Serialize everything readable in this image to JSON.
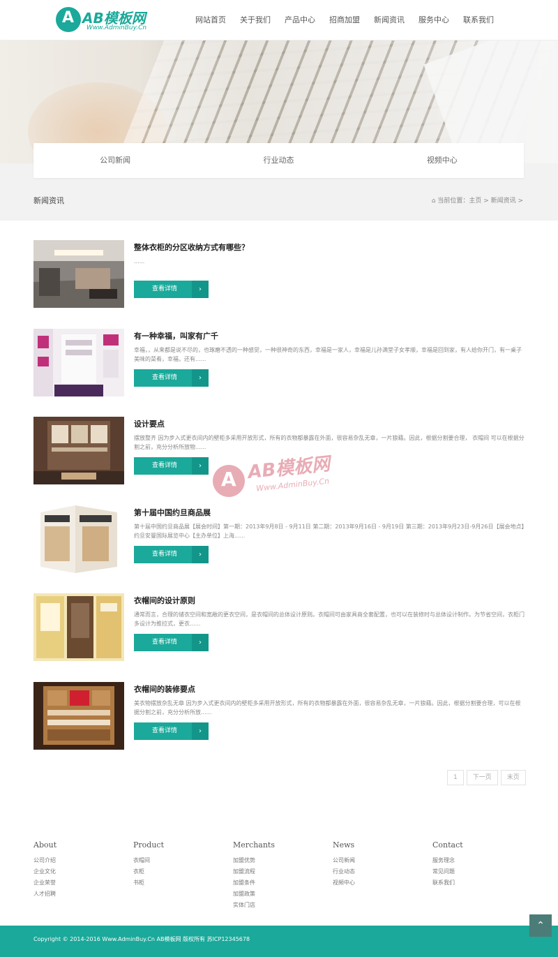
{
  "colors": {
    "accent": "#1aa99a",
    "accent_dark": "#12968a",
    "watermark": "#d76a7a"
  },
  "logo": {
    "text": "AB模板网",
    "letter": "A",
    "url": "Www.AdminBuy.Cn"
  },
  "nav": [
    "网站首页",
    "关于我们",
    "产品中心",
    "招商加盟",
    "新闻资讯",
    "服务中心",
    "联系我们"
  ],
  "tabs": [
    "公司新闻",
    "行业动态",
    "视频中心"
  ],
  "breadcrumb": {
    "page_title": "新闻资讯",
    "home_icon": "home-icon",
    "trail": "当前位置：主页 > 新闻资讯 >"
  },
  "articles": [
    {
      "title": "整体衣柜的分区收纳方式有哪些？",
      "desc": "......",
      "button": "查看详情",
      "arrow": "›",
      "image": "office-wardrobe-photo"
    },
    {
      "title": "有一种幸福，叫家有广千",
      "desc": "幸福，，从来都是说不尽的，也琢磨不透的一种感觉，一种很神奇的东西，幸福是一家人，幸福是儿孙满堂子女孝顺，幸福是回到家，有人给你开门，有一桌子美味的菜肴，幸福，还有......",
      "button": "查看详情",
      "arrow": "›",
      "image": "pink-closet-photo"
    },
    {
      "title": "设计要点",
      "desc": "摆放整齐 因为步入式更衣间内的壁柜多采用开放形式，所有的衣物都暴露在外面，很容易杂乱无章，一片狼藉。因此，根据分割要合理， 衣帽间 可以在根据分割之前，充分分析所放物......",
      "button": "查看详情",
      "arrow": "›",
      "image": "walk-in-closet-photo"
    },
    {
      "title": "第十届中国约旦商品展",
      "desc": "第十届中国约旦商品展【展会时间】第一期：2013年9月8日 - 9月11日 第二期：2013年9月16日 - 9月19日 第三期：2013年9月23日-9月26日【展会地点】约旦安曼国际展览中心【主办单位】上海......",
      "button": "查看详情",
      "arrow": "›",
      "image": "white-wardrobe-photo"
    },
    {
      "title": "衣帽间的设计原则",
      "desc": "通常而言，合理的储衣空间和宽敞的更衣空间，是衣帽间的总体设计原则。衣帽间可由家具商全套配置，也可以在装修时与总体设计制作。为节省空间，衣柜门多设计为推拉式，更衣......",
      "button": "查看详情",
      "arrow": "›",
      "image": "yellow-closet-photo"
    },
    {
      "title": "衣帽间的装修要点",
      "desc": "美衣物摆放杂乱无章 因为步入式更衣间内的壁柜多采用开放形式，所有的衣物都暴露在外面，很容易杂乱无章，一片狼藉。因此，根据分割要合理，可以在根据分割之前，充分分析所放......",
      "button": "查看详情",
      "arrow": "›",
      "image": "wood-shelves-photo"
    }
  ],
  "pagination": [
    "1",
    "下一页",
    "末页"
  ],
  "watermark": {
    "letter": "A",
    "text": "AB模板网",
    "url": "Www.AdminBuy.Cn"
  },
  "footer": {
    "columns": [
      {
        "title": "About",
        "links": [
          "公司介绍",
          "企业文化",
          "企业荣誉",
          "人才招聘"
        ]
      },
      {
        "title": "Product",
        "links": [
          "衣帽间",
          "衣柜",
          "书柜"
        ]
      },
      {
        "title": "Merchants",
        "links": [
          "加盟优势",
          "加盟流程",
          "加盟条件",
          "加盟政策",
          "实体门店"
        ]
      },
      {
        "title": "News",
        "links": [
          "公司新闻",
          "行业动态",
          "视频中心"
        ]
      },
      {
        "title": "Contact",
        "links": [
          "服务理念",
          "常见问题",
          "联系我们"
        ]
      }
    ],
    "to_top": "⌃",
    "copyright": "Copyright © 2014-2016 Www.AdminBuy.Cn AB模板网 版权所有 苏ICP12345678"
  }
}
